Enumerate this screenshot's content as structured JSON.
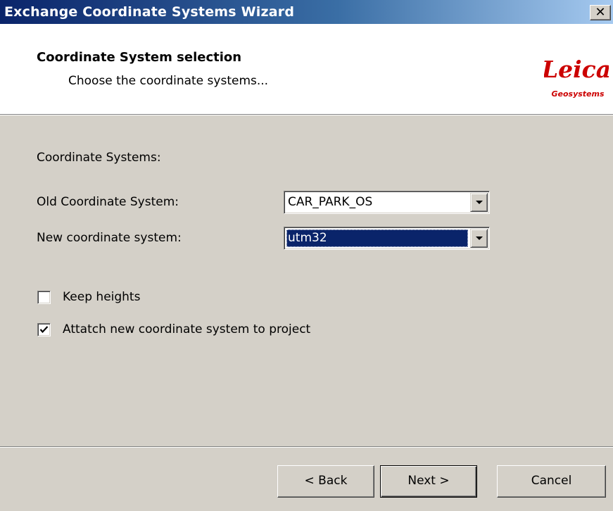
{
  "window": {
    "title": "Exchange Coordinate Systems Wizard",
    "close_glyph": "✕"
  },
  "header": {
    "title": "Coordinate System selection",
    "subtitle": "Choose the coordinate systems...",
    "logo": {
      "brand": "Leica",
      "tagline": "Geosystems",
      "color": "#cc0000"
    }
  },
  "form": {
    "section_label": "Coordinate Systems:",
    "old_cs": {
      "label": "Old Coordinate System:",
      "value": "CAR_PARK_OS"
    },
    "new_cs": {
      "label": "New coordinate system:",
      "value": "utm32"
    },
    "keep_heights": {
      "label": "Keep heights",
      "checked": false
    },
    "attach": {
      "label": "Attatch new coordinate system to project",
      "checked": true
    }
  },
  "buttons": {
    "back": "< Back",
    "next": "Next >",
    "cancel": "Cancel"
  },
  "colors": {
    "selection": "#0a246a",
    "face": "#d4d0c8",
    "titlebar_start": "#0a246a",
    "titlebar_end": "#a6caf0"
  }
}
